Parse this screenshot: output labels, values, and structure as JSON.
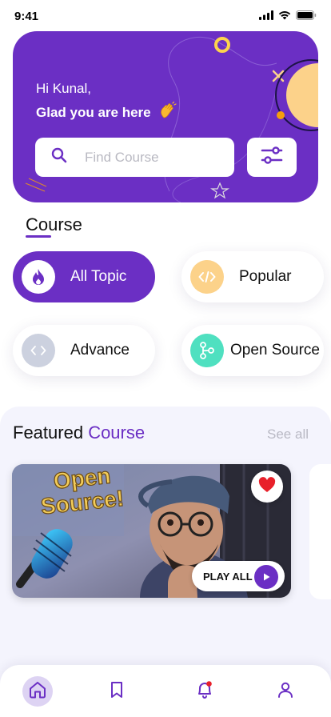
{
  "status_bar": {
    "time": "9:41"
  },
  "hero": {
    "greeting": "Hi Kunal,",
    "welcome": "Glad you are here",
    "search_placeholder": "Find Course"
  },
  "course_section": {
    "title": "Course",
    "categories": [
      {
        "label": "All Topic",
        "icon": "fire-icon",
        "active": true
      },
      {
        "label": "Popular",
        "icon": "code-icon",
        "active": false
      },
      {
        "label": "Advance",
        "icon": "chevrons-icon",
        "active": false
      },
      {
        "label": "Open Source",
        "icon": "git-branch-icon",
        "active": false
      }
    ]
  },
  "featured": {
    "title_prefix": "Featured",
    "title_accent": "Course",
    "see_all": "See all",
    "card": {
      "thumbnail_text_line1": "Open",
      "thumbnail_text_line2": "Source!",
      "play_all_label": "PLAY ALL",
      "favorited": true
    }
  },
  "bottom_nav": [
    {
      "name": "home",
      "icon": "home-icon",
      "active": true
    },
    {
      "name": "bookmark",
      "icon": "bookmark-icon",
      "active": false
    },
    {
      "name": "notifications",
      "icon": "bell-icon",
      "active": false,
      "badge": true
    },
    {
      "name": "profile",
      "icon": "user-icon",
      "active": false
    }
  ],
  "colors": {
    "primary": "#6b2fc4",
    "accent_orange": "#f59e0b",
    "accent_yellow": "#fcd28a",
    "accent_teal": "#4fe0c0",
    "favorite_red": "#e8202a"
  }
}
